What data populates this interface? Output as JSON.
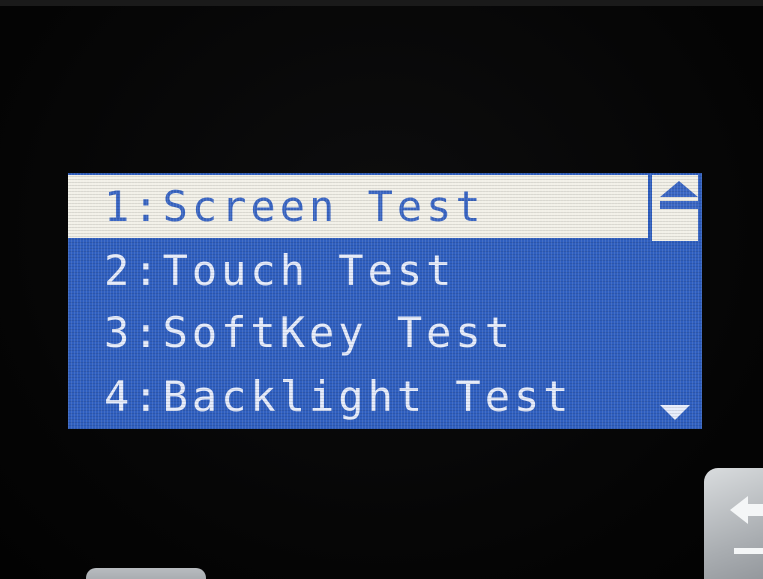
{
  "menu": {
    "items": [
      {
        "label": "1:Screen Test",
        "selected": true
      },
      {
        "label": "2:Touch Test",
        "selected": false
      },
      {
        "label": "3:SoftKey Test",
        "selected": false
      },
      {
        "label": "4:Backlight Test",
        "selected": false
      }
    ]
  },
  "scrollbar": {
    "up_icon": "arrow-up-icon",
    "down_icon": "arrow-down-icon"
  },
  "hardware": {
    "right_key_icon": "back-arrow-icon"
  },
  "colors": {
    "lcd_background": "#2f5fc0",
    "selection_background": "#f2f0e8",
    "selected_text": "#3a66c4",
    "text": "#e6ecfb"
  }
}
